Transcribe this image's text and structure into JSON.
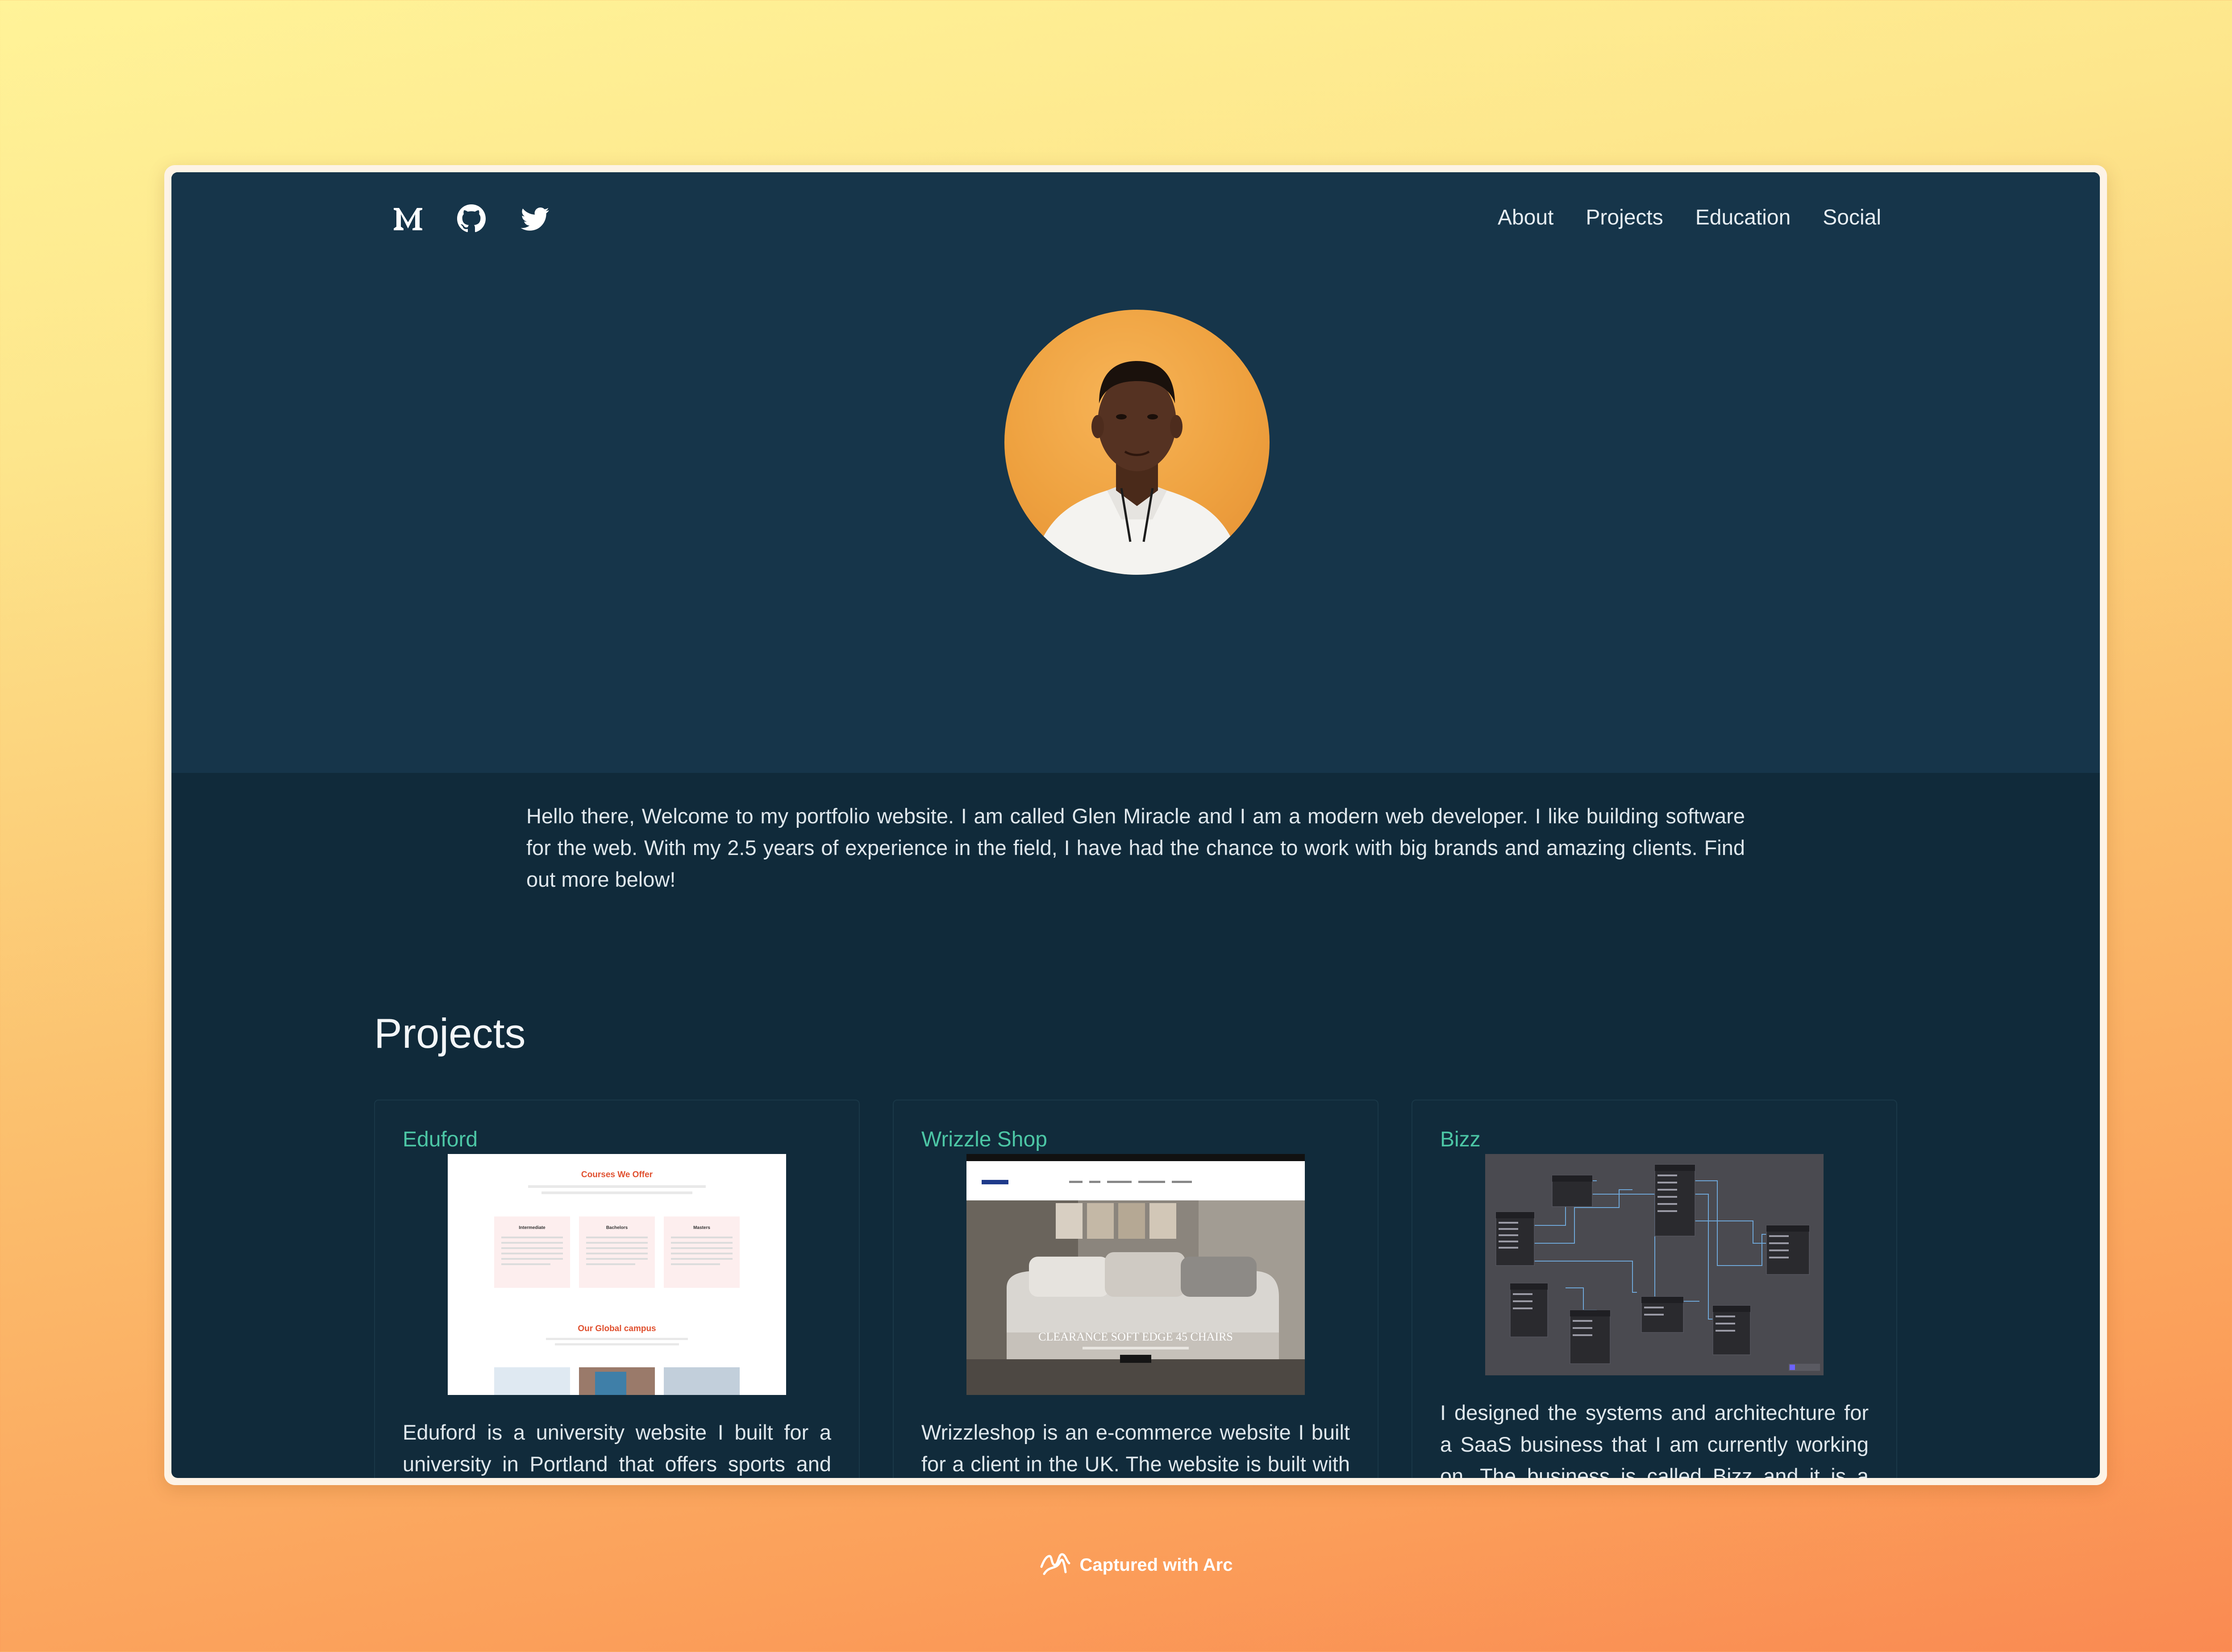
{
  "nav": {
    "social_icons": [
      "medium-icon",
      "github-icon",
      "twitter-icon"
    ],
    "links": [
      "About",
      "Projects",
      "Education",
      "Social"
    ]
  },
  "hero": {
    "intro": "Hello there, Welcome to my portfolio website. I am called Glen Miracle and I am a modern web developer. I like building software for the web. With my 2.5 years of experience in the field, I have had the chance to work with big brands and amazing clients. Find out more below!"
  },
  "projects": {
    "heading": "Projects",
    "items": [
      {
        "title": "Eduford",
        "description": "Eduford is a university website I built for a university in Portland that offers sports and Engineering courses and offer good scholarships to underprivilledged students from Africa. Click the tile to check it out!",
        "thumb": {
          "heading": "Courses We Offer",
          "col1": "Intermediate",
          "col2": "Bachelors",
          "col3": "Masters",
          "heading2": "Our Global campus"
        }
      },
      {
        "title": "Wrizzle Shop",
        "description": "Wrizzleshop is an e-commerce website I built for a client in the UK. The website is built with NextJs, Tailwind Css and Strapi. This project was one of the most complicated projects I have built so far. Click the title to check it out!",
        "thumb": {
          "banner": "CLEARANCE SOFT EDGE 45 CHAIRS"
        }
      },
      {
        "title": "Bizz",
        "description": "I designed the systems and architechture for a SaaS business that I am currently working on. The business is called Bizz and it is a business management software for small businesses. The software is built with NextJs, Tailwind Css, Superbase, MYSQL and Strapi."
      }
    ]
  },
  "footer": {
    "text": "Captured with Arc"
  },
  "colors": {
    "hero_bg": "#16354a",
    "section_bg": "#102a3a",
    "accent": "#4cc6a5"
  }
}
